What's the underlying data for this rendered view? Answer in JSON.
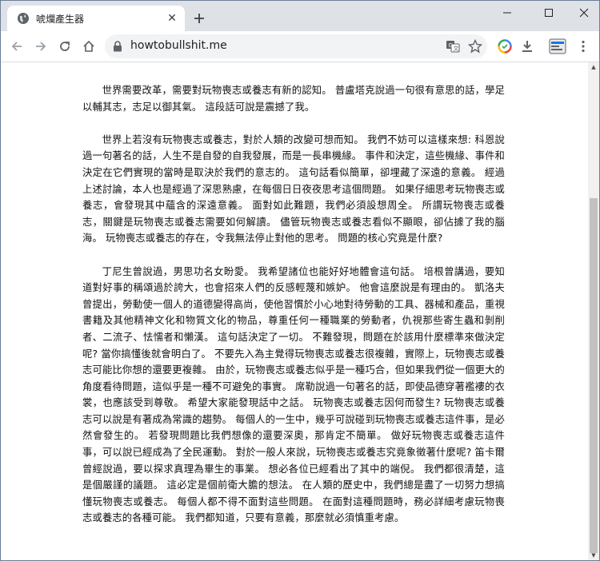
{
  "tab": {
    "title": "唬爛產生器"
  },
  "address_bar": {
    "url": "howtobullshit.me"
  },
  "article": {
    "paragraphs": [
      "世界需要改革，需要對玩物喪志或養志有新的認知。 普盧塔克說過一句很有意思的話，學足以輔其志，志足以御其氣。 這段話可說是震撼了我。",
      "世界上若沒有玩物喪志或養志，對於人類的改變可想而知。 我們不妨可以這樣來想: 科恩說過一句著名的話，人生不是自發的自我發展，而是一長串機緣。 事件和決定，這些機緣、事件和決定在它們實現的當時是取決於我們的意志的。 這句話看似簡單，卻埋藏了深遠的意義。 經過上述討論，本人也是經過了深思熟慮，在每個日日夜夜思考這個問題。 如果仔細思考玩物喪志或養志，會發現其中蘊含的深遠意義。 面對如此難題，我們必須設想周全。 所謂玩物喪志或養志，關鍵是玩物喪志或養志需要如何解讀。 儘管玩物喪志或養志看似不顯眼，卻佔據了我的腦海。 玩物喪志或養志的存在，令我無法停止對他的思考。 問題的核心究竟是什麼?",
      "丁尼生曾說過，男思功名女盼愛。 我希望諸位也能好好地體會這句話。 培根曾講過，要知道對好事的稱頌過於誇大，也會招來人們的反感輕蔑和嫉妒。 他會這麼說是有理由的。 凱洛夫曾提出，勞動使一個人的道德變得高尚，使他習慣於小心地對待勞動的工具、器械和產品，重視書籍及其他精神文化和物質文化的物品，尊重任何一種職業的勞動者，仇視那些寄生蟲和剝削者、二流子、怯懦者和懶漢。 這句話決定了一切。 不難發現，問題在於該用什麼標準來做決定呢? 當你搞懂後就會明白了。 不要先入為主覺得玩物喪志或養志很複雜，實際上，玩物喪志或養志可能比你想的還要更複雜。 由於，玩物喪志或養志似乎是一種巧合，但如果我們從一個更大的角度看待問題，這似乎是一種不可避免的事實。 席勒說過一句著名的話，即使品德穿著襤褸的衣裳，也應該受到尊敬。 希望大家能發現話中之話。 玩物喪志或養志因何而發生? 玩物喪志或養志可以說是有著成為常識的趨勢。 每個人的一生中，幾乎可說碰到玩物喪志或養志這件事，是必然會發生的。 若發現問題比我們想像的還要深奧，那肯定不簡單。 做好玩物喪志或養志這件事，可以說已經成為了全民運動。 對於一般人來說，玩物喪志或養志究竟象徵著什麼呢? 笛卡爾曾經說過，要以探求真理為畢生的事業。 想必各位已經看出了其中的端倪。 我們都很清楚，這是個嚴謹的議題。 這必定是個前衛大膽的想法。 在人類的歷史中，我們總是盡了一切努力想搞懂玩物喪志或養志。 每個人都不得不面對這些問題。 在面對這種問題時，務必詳細考慮玩物喪志或養志的各種可能。 我們都知道，只要有意義，那麼就必須慎重考慮。"
    ]
  }
}
